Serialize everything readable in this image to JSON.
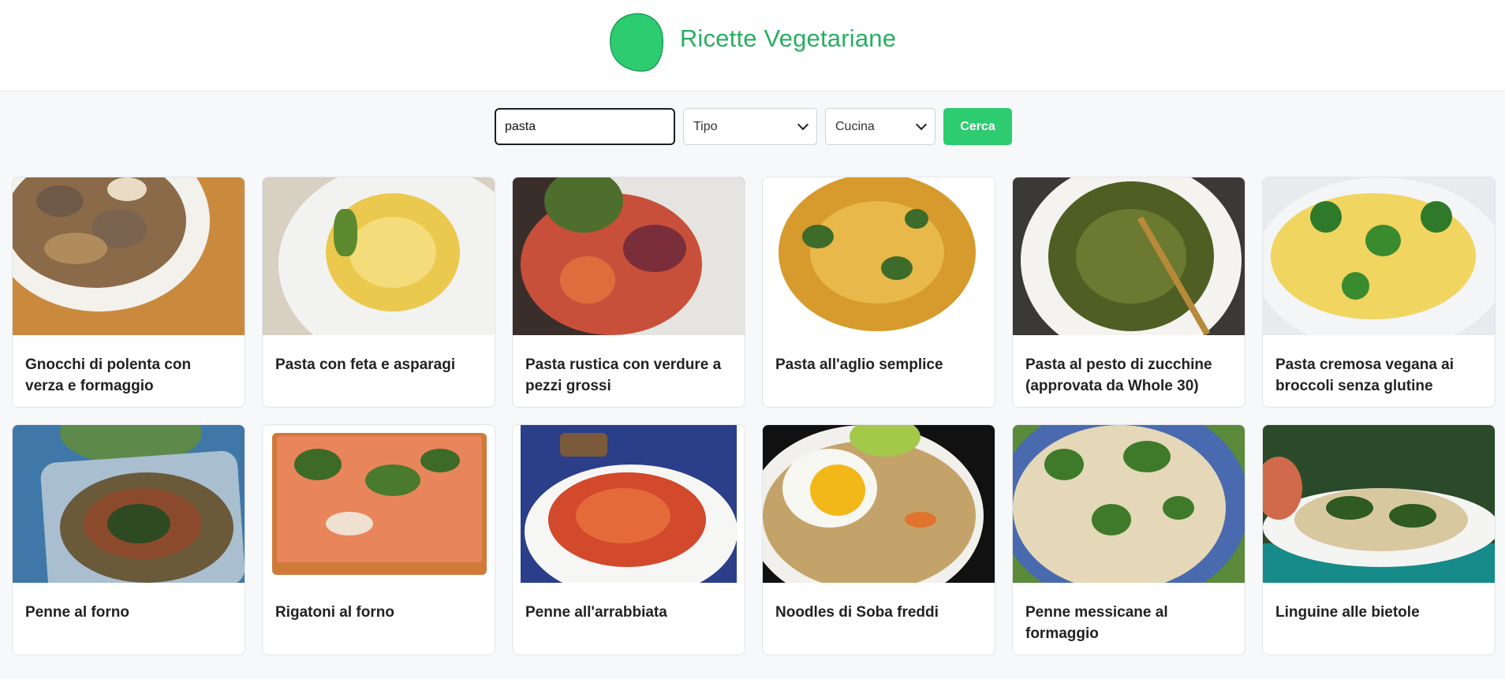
{
  "header": {
    "title": "Ricette Vegetariane",
    "logo_icon": "green-blob-logo-icon",
    "logo_color": "#2ecc71"
  },
  "search": {
    "value": "pasta",
    "type_select": "Tipo",
    "cuisine_select": "Cucina",
    "button_label": "Cerca"
  },
  "recipes": [
    {
      "title": "Gnocchi di polenta con verza e formaggio"
    },
    {
      "title": "Pasta con feta e asparagi"
    },
    {
      "title": "Pasta rustica con verdure a pezzi grossi"
    },
    {
      "title": "Pasta all'aglio semplice"
    },
    {
      "title": "Pasta al pesto di zucchine (approvata da Whole 30)"
    },
    {
      "title": "Pasta cremosa vegana ai broccoli senza glutine"
    },
    {
      "title": "Penne al forno"
    },
    {
      "title": "Rigatoni al forno"
    },
    {
      "title": "Penne all'arrabbiata"
    },
    {
      "title": "Noodles di Soba freddi"
    },
    {
      "title": "Penne messicane al formaggio"
    },
    {
      "title": "Linguine alle bietole"
    }
  ],
  "colors": {
    "accent": "#2ecc71",
    "title_green": "#27ae60"
  }
}
